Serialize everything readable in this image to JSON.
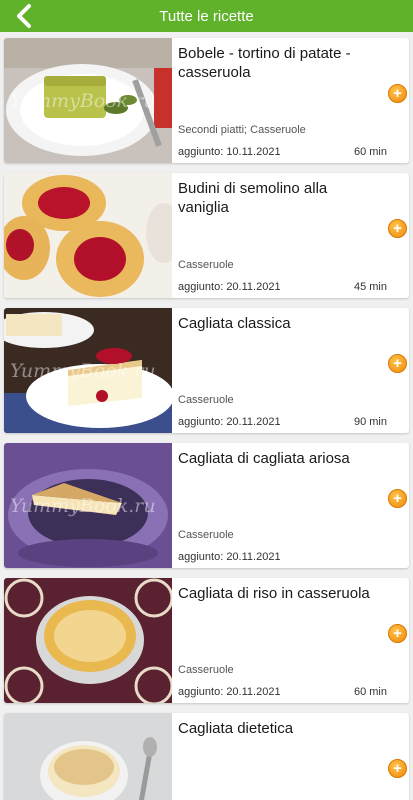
{
  "header": {
    "title": "Tutte le ricette",
    "back_icon": "chevron-left-icon"
  },
  "colors": {
    "accent": "#5fb22a",
    "add_button": "#f39c12"
  },
  "watermark": "YummyBook.ru",
  "recipes": [
    {
      "title": "Bobele - tortino di patate - casseruola",
      "category": "Secondi piatti; Casseruole",
      "date": "aggiunto: 10.11.2021",
      "time": "60 min"
    },
    {
      "title": "Budini di semolino alla vaniglia",
      "category": "Casseruole",
      "date": "aggiunto: 20.11.2021",
      "time": "45 min"
    },
    {
      "title": "Cagliata classica",
      "category": "Casseruole",
      "date": "aggiunto: 20.11.2021",
      "time": "90 min"
    },
    {
      "title": "Cagliata di cagliata ariosa",
      "category": "Casseruole",
      "date": "aggiunto: 20.11.2021",
      "time": ""
    },
    {
      "title": "Cagliata di riso in casseruola",
      "category": "Casseruole",
      "date": "aggiunto: 20.11.2021",
      "time": "60 min"
    },
    {
      "title": "Cagliata dietetica",
      "category": "",
      "date": "",
      "time": ""
    }
  ]
}
